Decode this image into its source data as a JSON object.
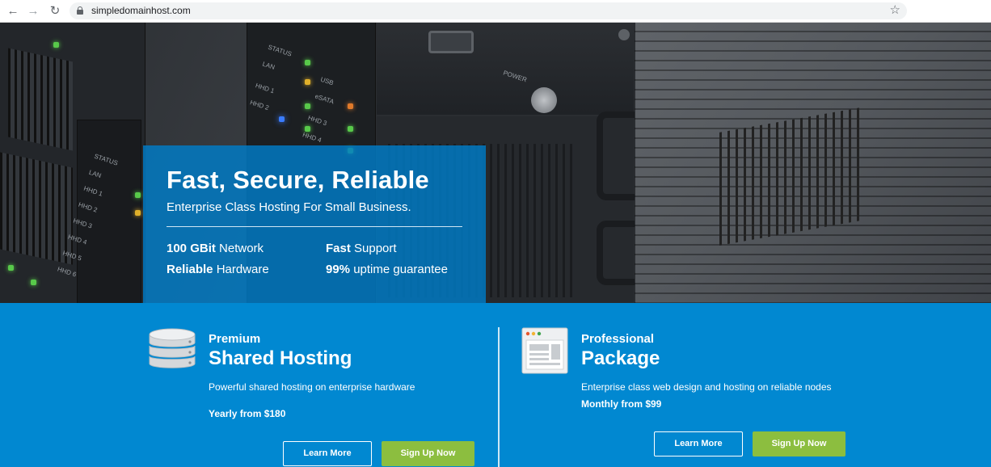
{
  "browser": {
    "url": "simpledomainhost.com",
    "back_icon": "arrow-left-icon",
    "forward_icon": "arrow-right-icon",
    "reload_icon": "reload-icon",
    "lock_icon": "lock-icon",
    "bookmark_icon": "star-icon"
  },
  "hero": {
    "title": "Fast, Secure, Reliable",
    "subtitle": "Enterprise Class Hosting For Small Business.",
    "features": [
      {
        "bold": "100 GBit",
        "rest": " Network"
      },
      {
        "bold": "Fast",
        "rest": " Support"
      },
      {
        "bold": "Reliable",
        "rest": " Hardware"
      },
      {
        "bold": "99%",
        "rest": " uptime guarantee"
      }
    ],
    "photo_labels": {
      "status": "STATUS",
      "lan": "LAN",
      "usb": "USB",
      "esata": "eSATA",
      "hhd1": "HHD 1",
      "hhd2": "HHD 2",
      "hhd3": "HHD 3",
      "hhd4": "HHD 4",
      "power": "POWER",
      "status2": "STATUS",
      "lan2": "LAN",
      "hhd1b": "HHD 1",
      "hhd2b": "HHD 2",
      "hhd3b": "HHD 3",
      "hhd4b": "HHD 4",
      "hhd5b": "HHD 5",
      "hhd6b": "HHD 6"
    }
  },
  "plans": [
    {
      "kicker": "Premium",
      "name": "Shared Hosting",
      "description": "Powerful shared hosting on enterprise hardware",
      "price": "Yearly from $180",
      "learn_label": "Learn More",
      "signup_label": "Sign Up Now",
      "icon": "database-icon"
    },
    {
      "kicker": "Professional",
      "name": "Package",
      "description": "Enterprise class web design and hosting on reliable nodes",
      "price": "Monthly from $99",
      "learn_label": "Learn More",
      "signup_label": "Sign Up Now",
      "icon": "browser-window-icon"
    }
  ],
  "colors": {
    "hero_box": "#007dc8",
    "lower_bg": "#0188d1",
    "signup_green": "#8cbe3f"
  }
}
